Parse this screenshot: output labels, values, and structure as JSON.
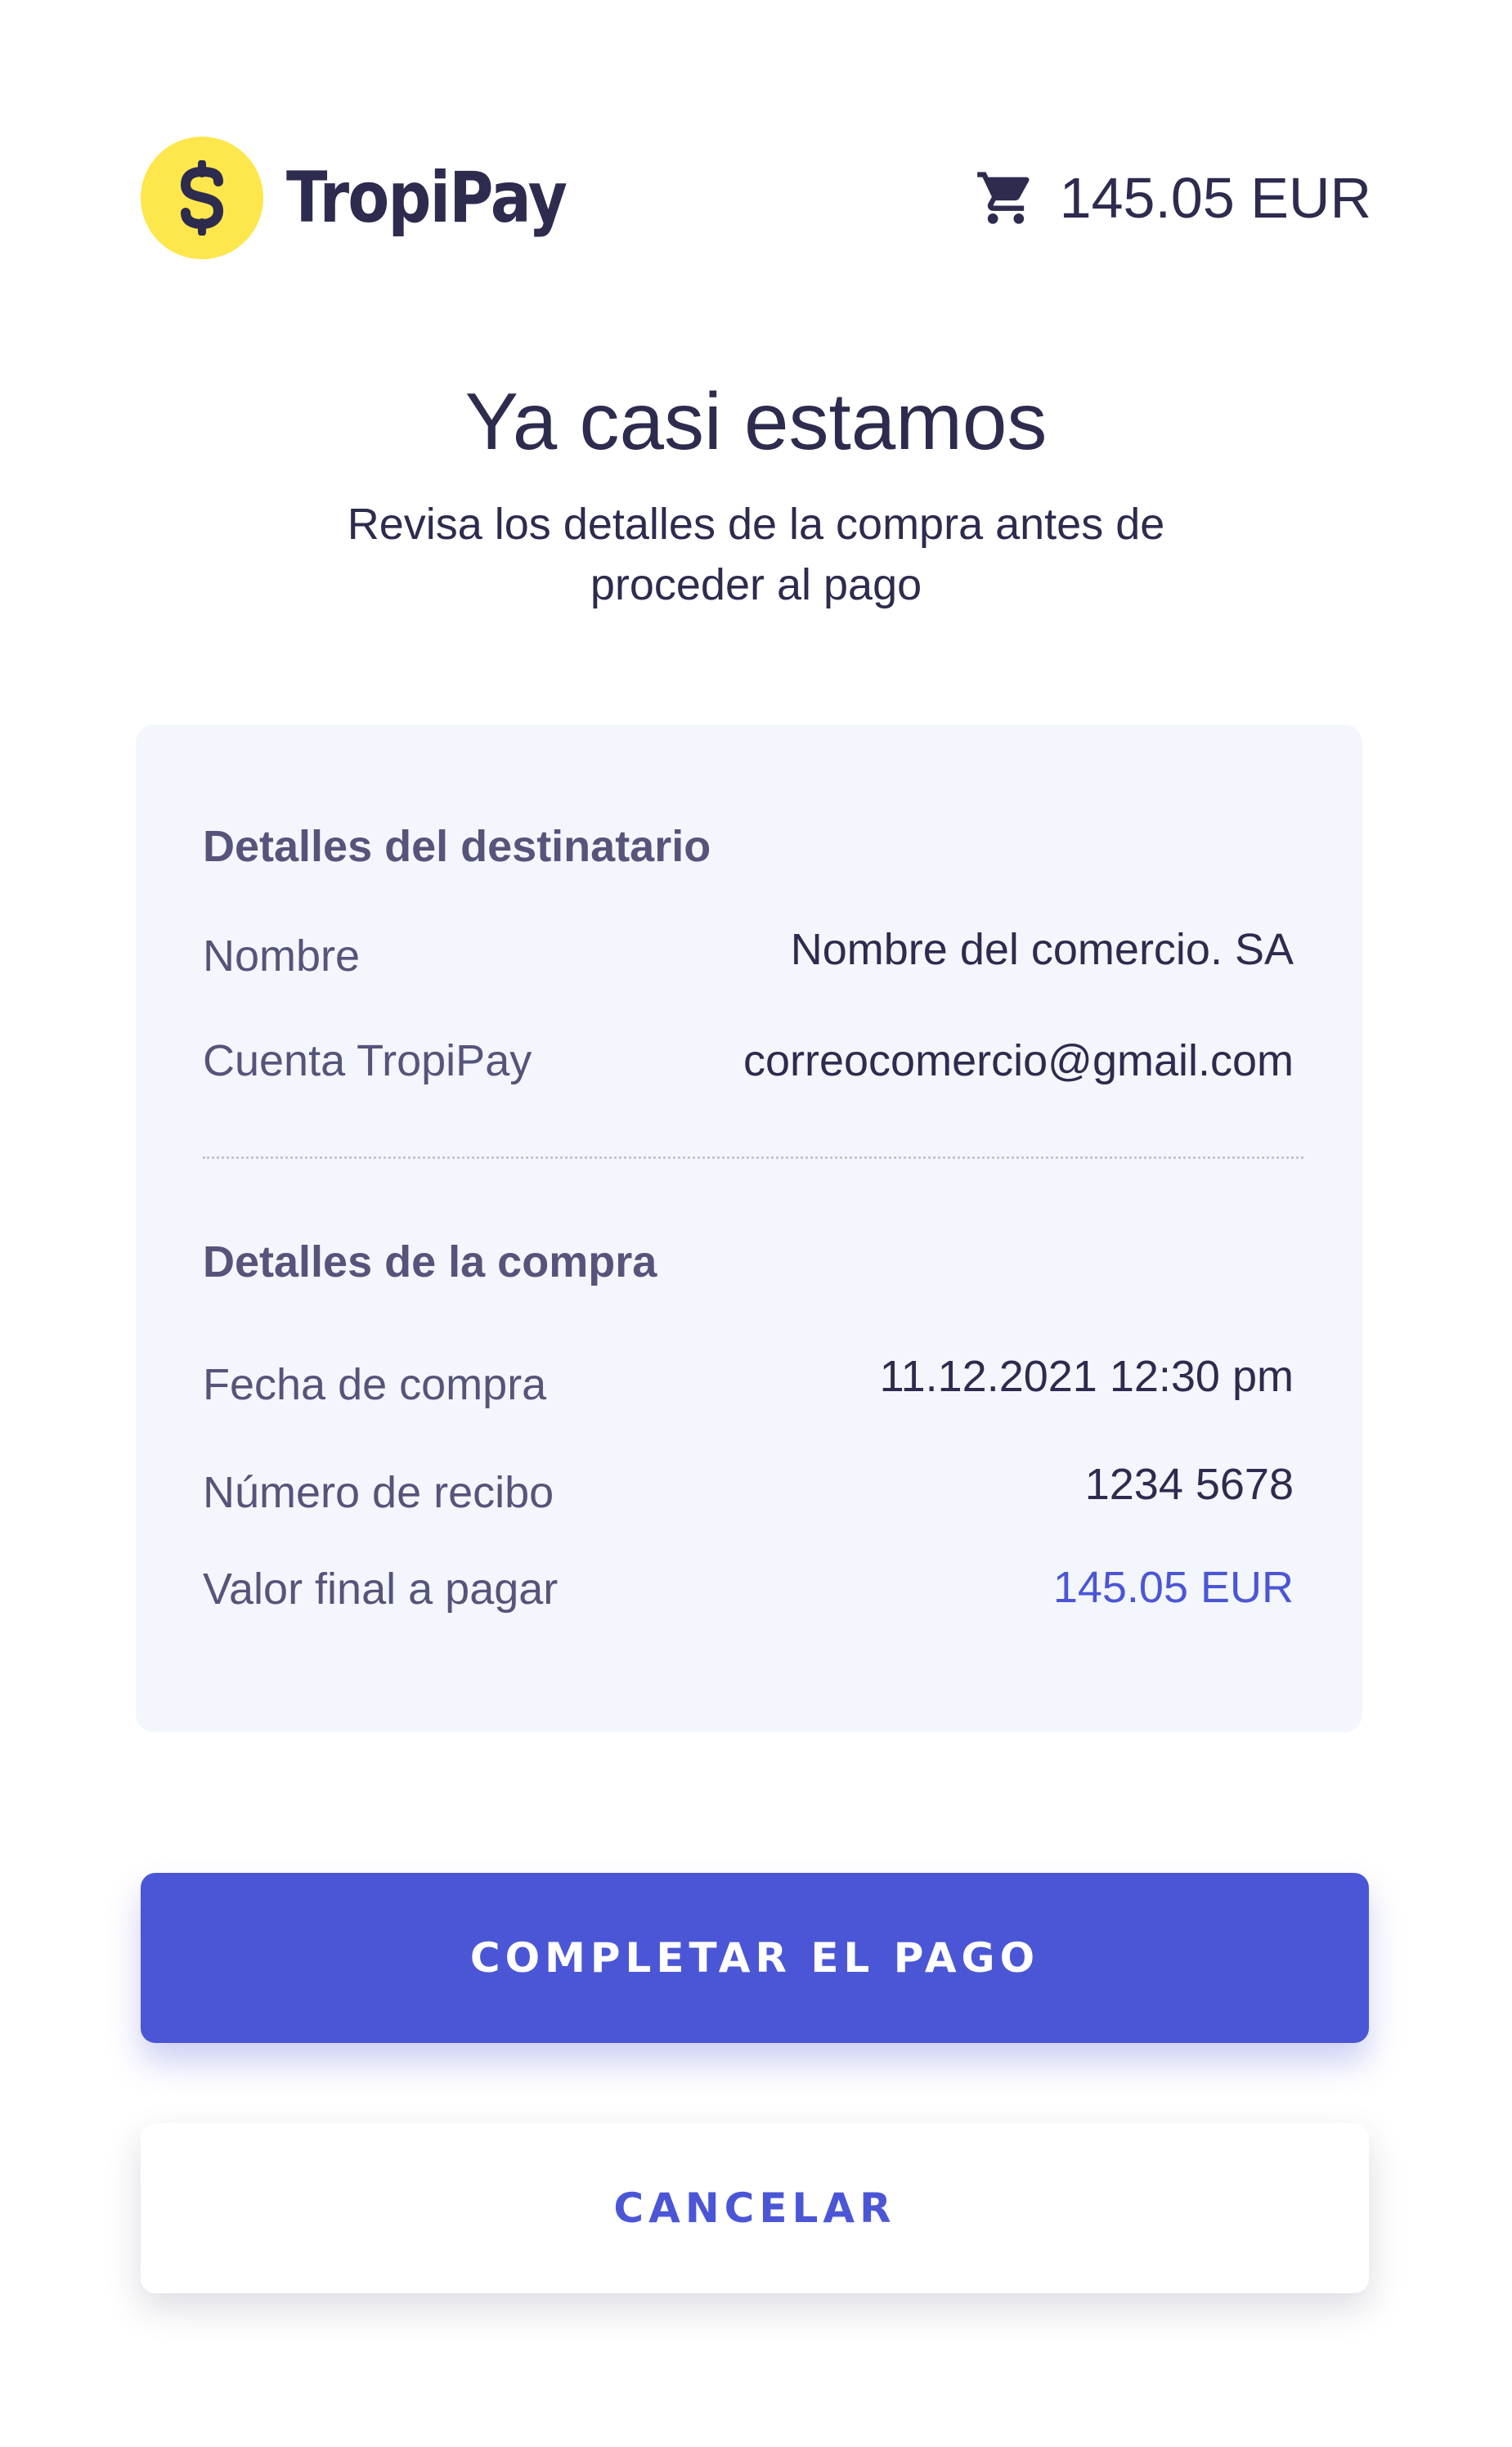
{
  "brand": {
    "name": "TropiPay",
    "logo_icon": "dollar-sign-icon",
    "logo_color": "#fde74c"
  },
  "cart": {
    "icon": "cart-icon",
    "amount": "145.05 EUR"
  },
  "page": {
    "title": "Ya casi estamos",
    "subtitle": "Revisa los detalles de la compra antes de proceder al pago"
  },
  "recipient": {
    "heading": "Detalles del destinatario",
    "rows": [
      {
        "label": "Nombre",
        "value": "Nombre del comercio. SA"
      },
      {
        "label": "Cuenta TropiPay",
        "value": "correocomercio@gmail.com"
      }
    ]
  },
  "purchase": {
    "heading": "Detalles de la compra",
    "rows": [
      {
        "label": "Fecha de compra",
        "value": "11.12.2021 12:30 pm"
      },
      {
        "label": "Número de recibo",
        "value": "1234 5678"
      },
      {
        "label": "Valor final a pagar",
        "value": "145.05 EUR"
      }
    ]
  },
  "actions": {
    "complete_label": "COMPLETAR EL PAGO",
    "cancel_label": "CANCELAR"
  },
  "colors": {
    "accent": "#4b56d6",
    "text": "#2d2b4e",
    "muted": "#56547a",
    "card_bg": "#f3f6fd"
  }
}
